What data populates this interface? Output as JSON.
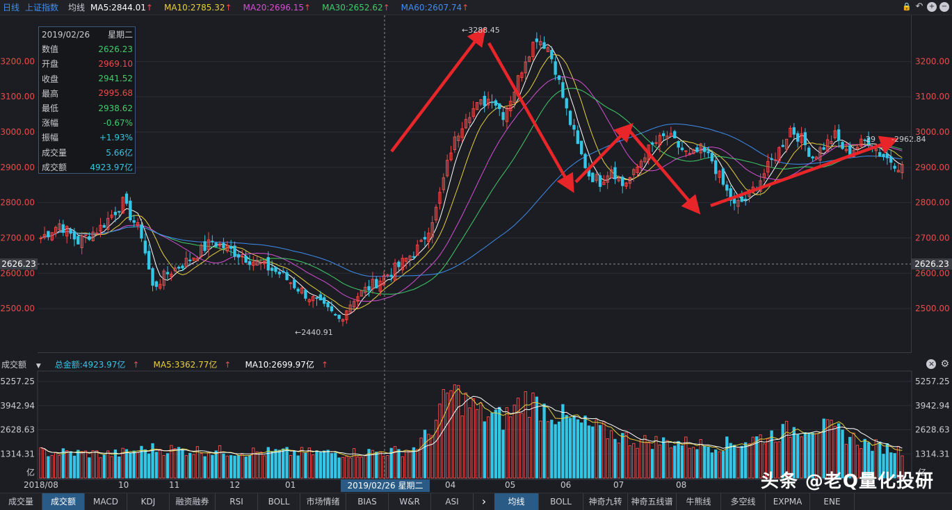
{
  "header": {
    "period": "日线",
    "index_name": "上证指数",
    "indicator": "均线",
    "ma": [
      {
        "label": "MA5:2844.01",
        "color": "#ffffff"
      },
      {
        "label": "MA10:2785.32",
        "color": "#e8d03a"
      },
      {
        "label": "MA20:2696.15",
        "color": "#d64fd6"
      },
      {
        "label": "MA30:2652.62",
        "color": "#3fce6a"
      },
      {
        "label": "MA60:2607.74",
        "color": "#3f8ff0"
      }
    ],
    "arrow": "↑"
  },
  "info": {
    "date": "2019/02/26",
    "weekday": "星期二",
    "rows": [
      {
        "k": "数值",
        "v": "2626.23",
        "c": "#3fce6a"
      },
      {
        "k": "开盘",
        "v": "2969.10",
        "c": "#ef4a4a"
      },
      {
        "k": "收盘",
        "v": "2941.52",
        "c": "#3fce6a"
      },
      {
        "k": "最高",
        "v": "2995.68",
        "c": "#ef4a4a"
      },
      {
        "k": "最低",
        "v": "2938.62",
        "c": "#3fce6a"
      },
      {
        "k": "涨幅",
        "v": "-0.67%",
        "c": "#3fce6a"
      },
      {
        "k": "振幅",
        "v": "+1.93%",
        "c": "#35c6e6"
      },
      {
        "k": "成交量",
        "v": "5.66亿",
        "c": "#35c6e6"
      },
      {
        "k": "成交额",
        "v": "4923.97亿",
        "c": "#35c6e6"
      }
    ]
  },
  "chart_data": [
    {
      "type": "candlestick",
      "y_ticks": [
        "3200.00",
        "3100.00",
        "3000.00",
        "2900.00",
        "2800.00",
        "2700.00",
        "2600.00",
        "2500.00"
      ],
      "ylim": [
        2390,
        3315
      ],
      "crosshair_value": "2626.23",
      "annotations": {
        "high": "3288.45",
        "low": "2440.91",
        "right": "2962.84",
        "right_partial": "29"
      },
      "x_labels": [
        "2018/08",
        "10",
        "11",
        "12",
        "01",
        "04",
        "05",
        "06",
        "07",
        "08"
      ],
      "cursor_label": "2019/02/26 星期二",
      "close_anchors": [
        [
          0,
          2700
        ],
        [
          5,
          2740
        ],
        [
          10,
          2690
        ],
        [
          16,
          2730
        ],
        [
          22,
          2800
        ],
        [
          27,
          2710
        ],
        [
          30,
          2560
        ],
        [
          34,
          2600
        ],
        [
          40,
          2640
        ],
        [
          46,
          2690
        ],
        [
          52,
          2660
        ],
        [
          58,
          2630
        ],
        [
          64,
          2600
        ],
        [
          70,
          2550
        ],
        [
          76,
          2500
        ],
        [
          80,
          2470
        ],
        [
          84,
          2530
        ],
        [
          88,
          2560
        ],
        [
          92,
          2590
        ],
        [
          96,
          2620
        ],
        [
          102,
          2680
        ],
        [
          106,
          2780
        ],
        [
          110,
          2950
        ],
        [
          114,
          3050
        ],
        [
          118,
          3080
        ],
        [
          121,
          3100
        ],
        [
          124,
          3050
        ],
        [
          127,
          3120
        ],
        [
          130,
          3210
        ],
        [
          133,
          3270
        ],
        [
          136,
          3240
        ],
        [
          138,
          3180
        ],
        [
          141,
          3060
        ],
        [
          144,
          2960
        ],
        [
          147,
          2880
        ],
        [
          150,
          2860
        ],
        [
          153,
          2900
        ],
        [
          156,
          2850
        ],
        [
          159,
          2880
        ],
        [
          162,
          2940
        ],
        [
          165,
          2970
        ],
        [
          168,
          2990
        ],
        [
          171,
          2960
        ],
        [
          174,
          2930
        ],
        [
          177,
          2950
        ],
        [
          180,
          2920
        ],
        [
          183,
          2850
        ],
        [
          186,
          2790
        ],
        [
          189,
          2810
        ],
        [
          192,
          2850
        ],
        [
          195,
          2900
        ],
        [
          198,
          2950
        ],
        [
          201,
          3010
        ],
        [
          204,
          2980
        ],
        [
          207,
          2930
        ],
        [
          210,
          2960
        ],
        [
          213,
          2990
        ],
        [
          216,
          2940
        ],
        [
          219,
          2960
        ],
        [
          222,
          2980
        ],
        [
          225,
          2940
        ],
        [
          228,
          2920
        ],
        [
          231,
          2900
        ]
      ]
    },
    {
      "type": "bar",
      "y_ticks": [
        "5257.25",
        "3942.94",
        "2628.63",
        "1314.31"
      ],
      "unit": "亿",
      "ylim": [
        0,
        5600
      ],
      "volume_anchors": [
        [
          0,
          1400
        ],
        [
          20,
          1300
        ],
        [
          30,
          1600
        ],
        [
          40,
          1500
        ],
        [
          60,
          1400
        ],
        [
          80,
          1350
        ],
        [
          96,
          1450
        ],
        [
          100,
          1600
        ],
        [
          104,
          2400
        ],
        [
          107,
          3600
        ],
        [
          110,
          4800
        ],
        [
          113,
          4300
        ],
        [
          118,
          3500
        ],
        [
          124,
          3200
        ],
        [
          130,
          4300
        ],
        [
          136,
          3700
        ],
        [
          142,
          3100
        ],
        [
          150,
          2600
        ],
        [
          160,
          2000
        ],
        [
          170,
          1950
        ],
        [
          180,
          1750
        ],
        [
          188,
          1950
        ],
        [
          198,
          2450
        ],
        [
          206,
          2900
        ],
        [
          214,
          2500
        ],
        [
          222,
          1800
        ],
        [
          231,
          1500
        ]
      ]
    }
  ],
  "volume_header": {
    "menu_label": "成交额",
    "menu_caret": "▼",
    "total": "总金额:4923.97亿",
    "ma5": "MA5:3362.77亿",
    "ma10": "MA10:2699.97亿",
    "arrow": "↑"
  },
  "colors": {
    "up": "#ef4a4a",
    "down": "#35c6e6",
    "axis_text": "#ef4a4a",
    "grid": "#2b2e35"
  },
  "tabs_left": [
    "成交量",
    "成交额",
    "MACD",
    "KDJ",
    "融资融券",
    "RSI",
    "BOLL",
    "市场情绪",
    "BIAS",
    "W&R",
    "ASI"
  ],
  "tabs_right": [
    "均线",
    "BOLL",
    "神奇九转",
    "神奇五线谱",
    "牛熊线",
    "多空线",
    "EXPMA",
    "ENE"
  ],
  "tab_arrow": "›",
  "watermark": "头条 @老Q量化投研",
  "icons": [
    "lock-icon",
    "undo-icon",
    "zoom-in-icon",
    "zoom-out-icon",
    "close-icon",
    "settings-icon"
  ]
}
